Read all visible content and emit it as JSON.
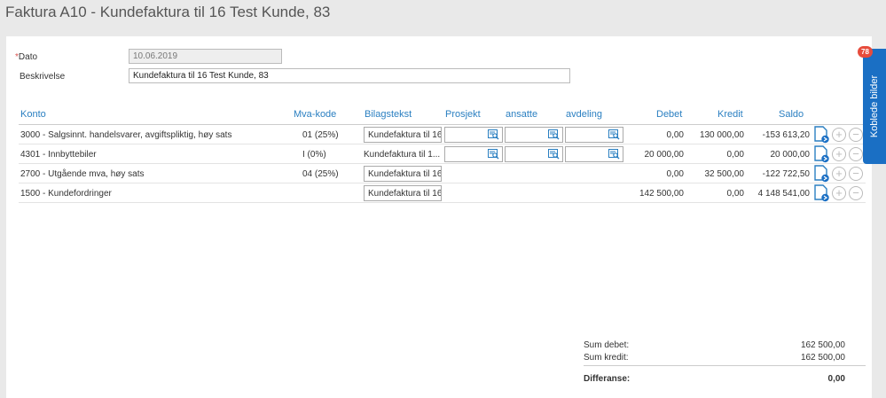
{
  "page": {
    "title": "Faktura A10  -  Kundefaktura til 16 Test Kunde, 83"
  },
  "form": {
    "date_label": "Dato",
    "date_required_mark": "*",
    "date_value": "10.06.2019",
    "description_label": "Beskrivelse",
    "description_value": "Kundefaktura til 16 Test Kunde, 83"
  },
  "table": {
    "headers": {
      "konto": "Konto",
      "mva": "Mva-kode",
      "bilag": "Bilagstekst",
      "prosjekt": "Prosjekt",
      "ansatte": "ansatte",
      "avdeling": "avdeling",
      "debet": "Debet",
      "kredit": "Kredit",
      "saldo": "Saldo"
    },
    "rows": [
      {
        "konto": "3000 - Salgsinnt. handelsvarer, avgiftspliktig, høy sats",
        "mva": "01 (25%)",
        "bilag": "Kundefaktura til 16",
        "debet": "0,00",
        "kredit": "130 000,00",
        "saldo": "-153 613,20"
      },
      {
        "konto": "4301 - Innbyttebiler",
        "mva": "I (0%)",
        "bilag": "Kundefaktura til 1...",
        "debet": "20 000,00",
        "kredit": "0,00",
        "saldo": "20 000,00"
      },
      {
        "konto": "2700 - Utgående mva, høy sats",
        "mva": "04 (25%)",
        "bilag": "Kundefaktura til 16",
        "debet": "0,00",
        "kredit": "32 500,00",
        "saldo": "-122 722,50"
      },
      {
        "konto": "1500 - Kundefordringer",
        "mva": "",
        "bilag": "Kundefaktura til 16",
        "debet": "142 500,00",
        "kredit": "0,00",
        "saldo": "4 148 541,00"
      }
    ]
  },
  "totals": {
    "sum_debet_label": "Sum debet:",
    "sum_debet": "162 500,00",
    "sum_kredit_label": "Sum kredit:",
    "sum_kredit": "162 500,00",
    "diff_label": "Differanse:",
    "diff": "0,00"
  },
  "sidebar": {
    "tab_label": "Koblede bilder",
    "badge_count": "78"
  },
  "colors": {
    "accent": "#2a7fc1",
    "tab": "#1a6fc4",
    "badge": "#e74c3c"
  },
  "icons": {
    "lookup": "search-list-icon",
    "document": "document-link-icon",
    "add": "plus-circle-icon",
    "remove": "minus-circle-icon"
  }
}
